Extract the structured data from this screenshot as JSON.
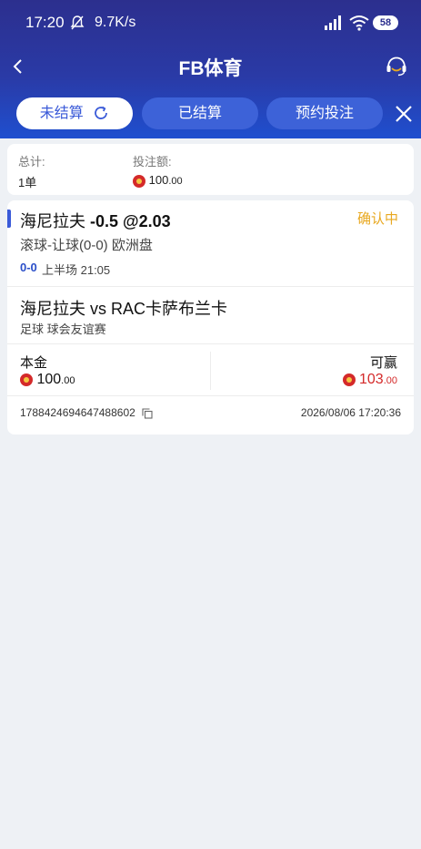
{
  "status_bar": {
    "time": "17:20",
    "net_speed": "9.7K/s",
    "battery": "58"
  },
  "header": {
    "title": "FB体育"
  },
  "tabs": [
    {
      "label": "未结算",
      "active": true
    },
    {
      "label": "已结算",
      "active": false
    },
    {
      "label": "预约投注",
      "active": false
    }
  ],
  "summary": {
    "total_label": "总计:",
    "total_value": "1单",
    "stake_label": "投注额:",
    "stake_int": "100",
    "stake_dec": ".00"
  },
  "bet": {
    "team": "海尼拉夫",
    "line_odds": "-0.5 @2.03",
    "status": "确认中",
    "market": "滚球-让球(0-0) 欧洲盘",
    "score": "0-0",
    "period": "上半场 21:05",
    "match": "海尼拉夫 vs RAC卡萨布兰卡",
    "league": "足球   球会友谊赛",
    "stake_label": "本金",
    "stake_int": "100",
    "stake_dec": ".00",
    "win_label": "可赢",
    "win_int": "103",
    "win_dec": ".00",
    "order_id": "1788424694647488602",
    "datetime": "2026/08/06 17:20:36"
  },
  "colors": {
    "accent": "#3a5ad8",
    "pending": "#e8a820",
    "win": "#d42a2a"
  }
}
